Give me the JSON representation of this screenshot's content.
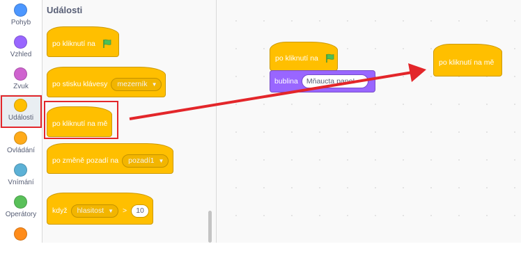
{
  "categories": [
    {
      "label": "Pohyb",
      "color": "#4c97ff"
    },
    {
      "label": "Vzhled",
      "color": "#9966ff"
    },
    {
      "label": "Zvuk",
      "color": "#cf63cf"
    },
    {
      "label": "Události",
      "color": "#ffbf00"
    },
    {
      "label": "Ovládání",
      "color": "#ffab19"
    },
    {
      "label": "Vnímání",
      "color": "#5cb1d6"
    },
    {
      "label": "Operátory",
      "color": "#59c059"
    },
    {
      "label": "",
      "color": "#ff8c1a"
    }
  ],
  "palette": {
    "title": "Události",
    "blocks": {
      "flag_clicked": "po kliknutí na",
      "key_pressed": "po stisku klávesy",
      "key_value": "mezerník",
      "sprite_clicked": "po kliknutí na mě",
      "backdrop_switch": "po změně pozadí na",
      "backdrop_value": "pozadí1",
      "greater_when": "když",
      "greater_sensor": "hlasitost",
      "greater_op": ">",
      "greater_value": "10"
    }
  },
  "workspace": {
    "flag_hat": "po kliknutí na",
    "say_label": "bublina",
    "say_value": "Mňaucta pane!",
    "sprite_hat": "po kliknutí na mě"
  },
  "colors": {
    "events": "#ffbf00",
    "looks": "#9966ff",
    "highlight": "#e3262a",
    "flag": "#4cbf56"
  }
}
